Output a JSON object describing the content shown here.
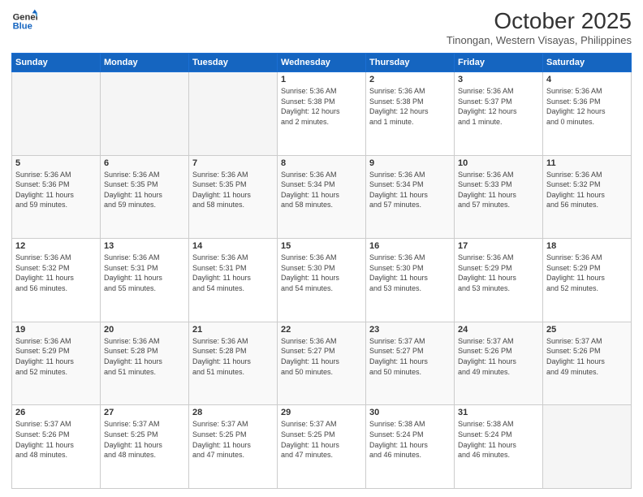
{
  "header": {
    "logo_line1": "General",
    "logo_line2": "Blue",
    "month_title": "October 2025",
    "subtitle": "Tinongan, Western Visayas, Philippines"
  },
  "weekdays": [
    "Sunday",
    "Monday",
    "Tuesday",
    "Wednesday",
    "Thursday",
    "Friday",
    "Saturday"
  ],
  "weeks": [
    [
      {
        "day": "",
        "info": ""
      },
      {
        "day": "",
        "info": ""
      },
      {
        "day": "",
        "info": ""
      },
      {
        "day": "1",
        "info": "Sunrise: 5:36 AM\nSunset: 5:38 PM\nDaylight: 12 hours\nand 2 minutes."
      },
      {
        "day": "2",
        "info": "Sunrise: 5:36 AM\nSunset: 5:38 PM\nDaylight: 12 hours\nand 1 minute."
      },
      {
        "day": "3",
        "info": "Sunrise: 5:36 AM\nSunset: 5:37 PM\nDaylight: 12 hours\nand 1 minute."
      },
      {
        "day": "4",
        "info": "Sunrise: 5:36 AM\nSunset: 5:36 PM\nDaylight: 12 hours\nand 0 minutes."
      }
    ],
    [
      {
        "day": "5",
        "info": "Sunrise: 5:36 AM\nSunset: 5:36 PM\nDaylight: 11 hours\nand 59 minutes."
      },
      {
        "day": "6",
        "info": "Sunrise: 5:36 AM\nSunset: 5:35 PM\nDaylight: 11 hours\nand 59 minutes."
      },
      {
        "day": "7",
        "info": "Sunrise: 5:36 AM\nSunset: 5:35 PM\nDaylight: 11 hours\nand 58 minutes."
      },
      {
        "day": "8",
        "info": "Sunrise: 5:36 AM\nSunset: 5:34 PM\nDaylight: 11 hours\nand 58 minutes."
      },
      {
        "day": "9",
        "info": "Sunrise: 5:36 AM\nSunset: 5:34 PM\nDaylight: 11 hours\nand 57 minutes."
      },
      {
        "day": "10",
        "info": "Sunrise: 5:36 AM\nSunset: 5:33 PM\nDaylight: 11 hours\nand 57 minutes."
      },
      {
        "day": "11",
        "info": "Sunrise: 5:36 AM\nSunset: 5:32 PM\nDaylight: 11 hours\nand 56 minutes."
      }
    ],
    [
      {
        "day": "12",
        "info": "Sunrise: 5:36 AM\nSunset: 5:32 PM\nDaylight: 11 hours\nand 56 minutes."
      },
      {
        "day": "13",
        "info": "Sunrise: 5:36 AM\nSunset: 5:31 PM\nDaylight: 11 hours\nand 55 minutes."
      },
      {
        "day": "14",
        "info": "Sunrise: 5:36 AM\nSunset: 5:31 PM\nDaylight: 11 hours\nand 54 minutes."
      },
      {
        "day": "15",
        "info": "Sunrise: 5:36 AM\nSunset: 5:30 PM\nDaylight: 11 hours\nand 54 minutes."
      },
      {
        "day": "16",
        "info": "Sunrise: 5:36 AM\nSunset: 5:30 PM\nDaylight: 11 hours\nand 53 minutes."
      },
      {
        "day": "17",
        "info": "Sunrise: 5:36 AM\nSunset: 5:29 PM\nDaylight: 11 hours\nand 53 minutes."
      },
      {
        "day": "18",
        "info": "Sunrise: 5:36 AM\nSunset: 5:29 PM\nDaylight: 11 hours\nand 52 minutes."
      }
    ],
    [
      {
        "day": "19",
        "info": "Sunrise: 5:36 AM\nSunset: 5:29 PM\nDaylight: 11 hours\nand 52 minutes."
      },
      {
        "day": "20",
        "info": "Sunrise: 5:36 AM\nSunset: 5:28 PM\nDaylight: 11 hours\nand 51 minutes."
      },
      {
        "day": "21",
        "info": "Sunrise: 5:36 AM\nSunset: 5:28 PM\nDaylight: 11 hours\nand 51 minutes."
      },
      {
        "day": "22",
        "info": "Sunrise: 5:36 AM\nSunset: 5:27 PM\nDaylight: 11 hours\nand 50 minutes."
      },
      {
        "day": "23",
        "info": "Sunrise: 5:37 AM\nSunset: 5:27 PM\nDaylight: 11 hours\nand 50 minutes."
      },
      {
        "day": "24",
        "info": "Sunrise: 5:37 AM\nSunset: 5:26 PM\nDaylight: 11 hours\nand 49 minutes."
      },
      {
        "day": "25",
        "info": "Sunrise: 5:37 AM\nSunset: 5:26 PM\nDaylight: 11 hours\nand 49 minutes."
      }
    ],
    [
      {
        "day": "26",
        "info": "Sunrise: 5:37 AM\nSunset: 5:26 PM\nDaylight: 11 hours\nand 48 minutes."
      },
      {
        "day": "27",
        "info": "Sunrise: 5:37 AM\nSunset: 5:25 PM\nDaylight: 11 hours\nand 48 minutes."
      },
      {
        "day": "28",
        "info": "Sunrise: 5:37 AM\nSunset: 5:25 PM\nDaylight: 11 hours\nand 47 minutes."
      },
      {
        "day": "29",
        "info": "Sunrise: 5:37 AM\nSunset: 5:25 PM\nDaylight: 11 hours\nand 47 minutes."
      },
      {
        "day": "30",
        "info": "Sunrise: 5:38 AM\nSunset: 5:24 PM\nDaylight: 11 hours\nand 46 minutes."
      },
      {
        "day": "31",
        "info": "Sunrise: 5:38 AM\nSunset: 5:24 PM\nDaylight: 11 hours\nand 46 minutes."
      },
      {
        "day": "",
        "info": ""
      }
    ]
  ]
}
